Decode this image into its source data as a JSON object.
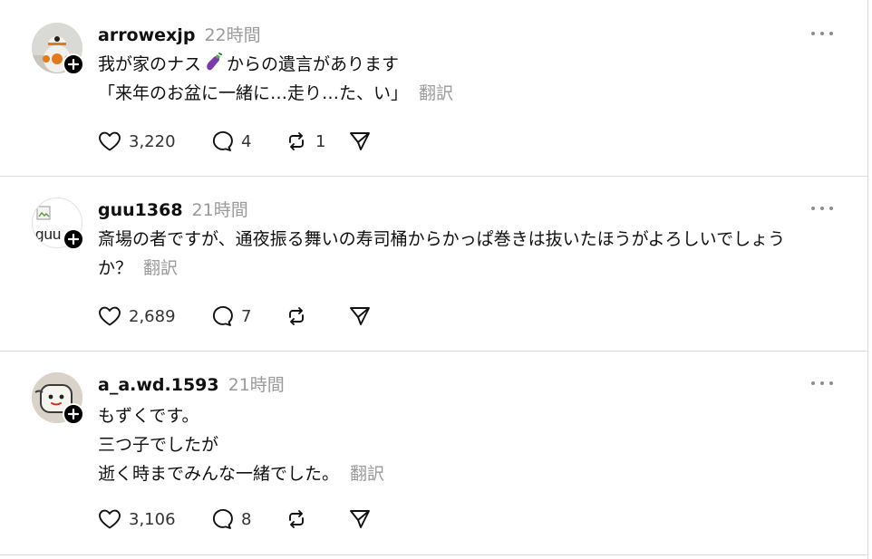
{
  "posts": [
    {
      "username": "arrowexjp",
      "time": "22時間",
      "lines": [
        "我が家のナス",
        "からの遺言があります",
        "「来年のお盆に一緒に…走り…た、い」"
      ],
      "emoji": "eggplant",
      "translate": "翻訳",
      "likes": "3,220",
      "replies": "4",
      "reposts": "1"
    },
    {
      "username": "guu1368",
      "time": "21時間",
      "avatar_alt": "guu",
      "lines": [
        "斎場の者ですが、通夜振る舞いの寿司桶からかっぱ巻きは抜いたほうがよろしいでしょう",
        "か？"
      ],
      "translate": "翻訳",
      "likes": "2,689",
      "replies": "7",
      "reposts": ""
    },
    {
      "username": "a_a.wd.1593",
      "time": "21時間",
      "lines": [
        "もずくです。",
        "三つ子でしたが",
        "逝く時までみんな一緒でした。"
      ],
      "translate": "翻訳",
      "likes": "3,106",
      "replies": "8",
      "reposts": ""
    }
  ],
  "icons": {
    "like": "heart-icon",
    "reply": "speech-bubble-icon",
    "repost": "repost-icon",
    "share": "paper-plane-icon",
    "more": "more-horizontal-icon",
    "follow": "plus-icon"
  },
  "colors": {
    "text": "#111111",
    "muted": "#9a9a9a",
    "divider": "#dcdcdc",
    "badge": "#000000"
  }
}
